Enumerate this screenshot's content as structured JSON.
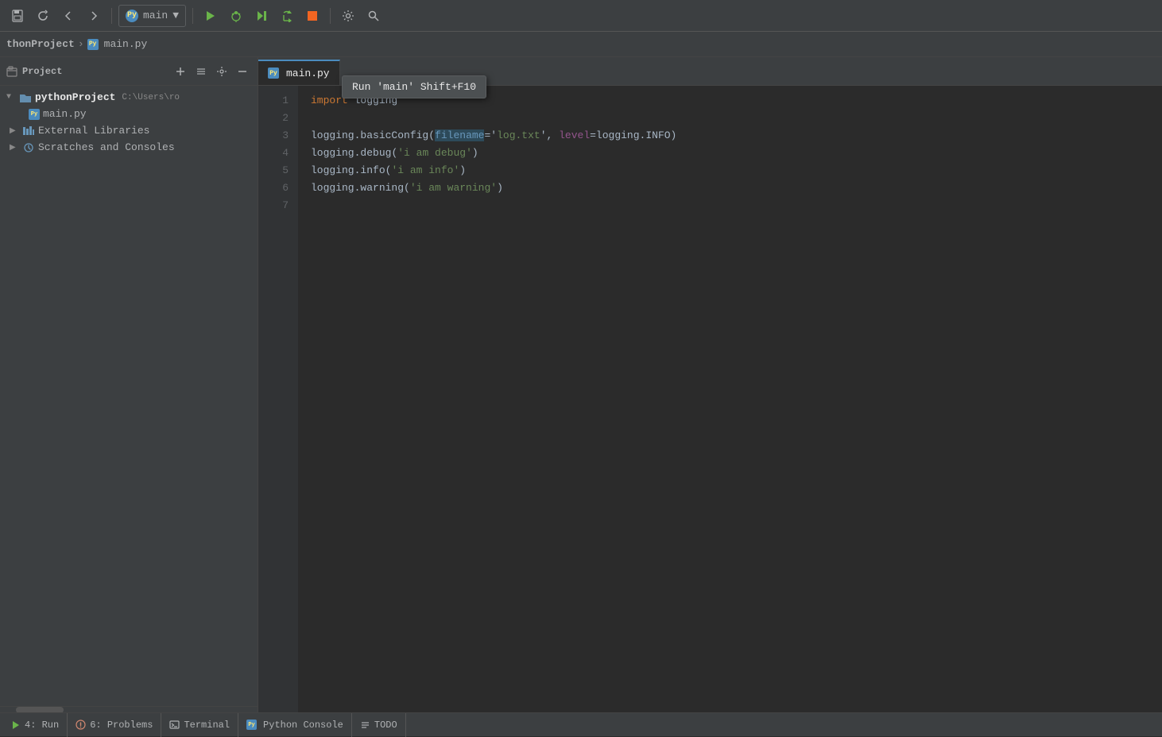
{
  "toolbar": {
    "run_config": "main",
    "run_config_dropdown": "▼",
    "tooltip_text": "Run 'main'  Shift+F10"
  },
  "breadcrumb": {
    "project_name": "thonProject",
    "separator": "›",
    "file_name": "main.py"
  },
  "sidebar": {
    "header_title": "Project",
    "project_item": {
      "label": "pythonProject",
      "path": "C:\\Users\\ro"
    },
    "children": [
      {
        "label": "main.py",
        "type": "py-file",
        "indent": 2
      }
    ],
    "external_libraries": {
      "label": "External Libraries",
      "type": "library",
      "indent": 1
    },
    "scratches": {
      "label": "Scratches and Consoles",
      "type": "scratch",
      "indent": 1
    }
  },
  "editor": {
    "tab_label": "main.py",
    "lines": [
      {
        "num": 1,
        "content": "import logging",
        "type": "import"
      },
      {
        "num": 2,
        "content": "",
        "type": "empty"
      },
      {
        "num": 3,
        "content": "logging.basicConfig(filename='log.txt', level=logging.INFO)",
        "type": "code"
      },
      {
        "num": 4,
        "content": "logging.debug('i am debug')",
        "type": "code"
      },
      {
        "num": 5,
        "content": "logging.info('i am info')",
        "type": "code"
      },
      {
        "num": 6,
        "content": "logging.warning('i am warning')",
        "type": "code"
      },
      {
        "num": 7,
        "content": "",
        "type": "empty"
      }
    ]
  },
  "status_bar": {
    "run_label": "4: Run",
    "problems_label": "6: Problems",
    "terminal_label": "Terminal",
    "console_label": "Python Console",
    "todo_label": "TODO"
  },
  "icons": {
    "save": "💾",
    "refresh": "↺",
    "back": "←",
    "forward": "→",
    "play": "▶",
    "debug": "🐞",
    "resume": "▶",
    "step_over": "↷",
    "stop": "■",
    "wrench": "🔧",
    "search": "🔍",
    "python": "Py",
    "folder": "📁",
    "library": "📊",
    "scratch": "🕐",
    "run": "▶",
    "problems": "ℹ",
    "terminal": "▭",
    "console": "Py"
  }
}
